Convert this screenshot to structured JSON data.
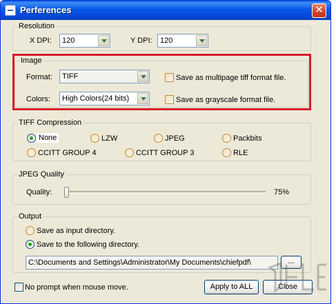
{
  "window": {
    "title": "Perferences",
    "close_glyph": "✕"
  },
  "resolution": {
    "label": "Resolution",
    "x_dpi_label": "X DPI:",
    "x_dpi_value": "120",
    "y_dpi_label": "Y DPI:",
    "y_dpi_value": "120"
  },
  "image": {
    "label": "Image",
    "format_label": "Format:",
    "format_value": "TIFF",
    "colors_label": "Colors:",
    "colors_value": "High Colors(24 bits)",
    "multipage_label": "Save as multipage tiff format file.",
    "grayscale_label": "Save as grayscale format file."
  },
  "tiff": {
    "label": "TIFF Compression",
    "options": [
      "None",
      "LZW",
      "JPEG",
      "Packbits",
      "CCITT GROUP 4",
      "CCITT GROUP 3",
      "RLE"
    ],
    "selected": "None"
  },
  "jpeg": {
    "label": "JPEG Quality",
    "quality_label": "Quality:",
    "quality_value": "75%",
    "quality_fraction": 0.0
  },
  "output": {
    "label": "Output",
    "option_input_dir": "Save as input directory.",
    "option_following_dir": "Save to the following directory.",
    "selected": "following",
    "directory": "C:\\Documents and Settings\\Administrator\\My Documents\\chiefpdf\\",
    "browse_label": "..."
  },
  "footer": {
    "no_prompt_label": "No prompt when mouse move.",
    "apply_all_label": "Apply to ALL",
    "close_label": "Close"
  },
  "colors": {
    "highlight": "#d71a2a",
    "title_bar": "#0758e8",
    "dialog_bg": "#ece9d8"
  }
}
